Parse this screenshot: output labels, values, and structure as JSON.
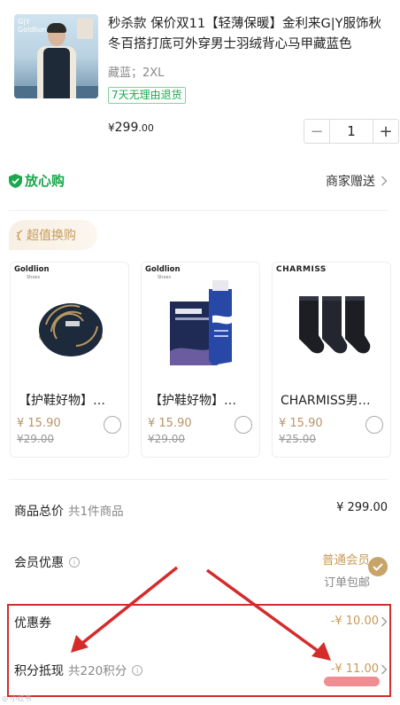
{
  "product": {
    "title": "秒杀款 保价双11【轻薄保暖】金利来G|Y服饰秋冬百搭打底可外穿男士羽绒背心马甲藏蓝色",
    "spec": "藏蓝；2XL",
    "badge": "7天无理由退货",
    "price_currency": "¥",
    "price_int": "299",
    "price_dec": ".00",
    "quantity": "1",
    "thumb_brand": "G|Y\nGoldlion"
  },
  "assurance": {
    "label": "放心购",
    "right_label": "商家赠送"
  },
  "swap": {
    "tag_label": "超值换购"
  },
  "cards": [
    {
      "logo": "Goldlion",
      "logo_sub": "Shoes",
      "name": "【护鞋好物】…",
      "price": "¥ 15.90",
      "orig": "¥29.00",
      "img": "shoe-polish-tin"
    },
    {
      "logo": "Goldlion",
      "logo_sub": "Shoes",
      "name": "【护鞋好物】…",
      "price": "¥ 15.90",
      "orig": "¥29.00",
      "img": "shoe-cleaner-tube"
    },
    {
      "logo": "CHARMISS",
      "logo_sub": "",
      "name": "CHARMISS男…",
      "price": "¥ 15.90",
      "orig": "¥25.00",
      "img": "black-socks"
    }
  ],
  "summary": {
    "total_label": "商品总价",
    "total_sub": "共1件商品",
    "total_value": "¥ 299.00",
    "member_label": "会员优惠",
    "member_level": "普通会员",
    "member_shipping": "订单包邮",
    "coupon_label": "优惠券",
    "coupon_value": "-¥ 10.00",
    "points_label": "积分抵现",
    "points_sub": "共220积分",
    "points_value": "-¥ 11.00"
  },
  "colors": {
    "green": "#1aa84c",
    "gold": "#c79a5a",
    "annotation_red": "#d42b2b"
  }
}
